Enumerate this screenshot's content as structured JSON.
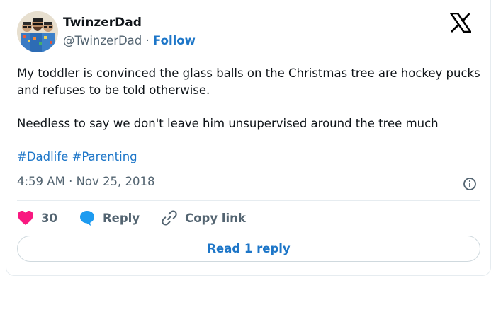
{
  "tweet": {
    "display_name": "TwinzerDad",
    "handle": "@TwinzerDad",
    "separator": "·",
    "follow_label": "Follow",
    "body_line_1": "My toddler is convinced the glass balls on the Christmas tree are hockey pucks and refuses to be told otherwise.",
    "body_line_2": "Needless to say we don't leave him unsupervised around the tree much",
    "hashtags": [
      "#Dadlife",
      "#Parenting"
    ],
    "time": "4:59 AM",
    "date": "Nov 25, 2018",
    "like_count": "30",
    "reply_label": "Reply",
    "copy_link_label": "Copy link",
    "read_reply_label": "Read 1 reply"
  },
  "icons": {
    "brand": "x-logo-icon",
    "like": "heart-icon",
    "reply": "reply-bubble-icon",
    "copy": "link-icon",
    "info": "info-icon"
  },
  "colors": {
    "link": "#1d76c8",
    "heart": "#f91880",
    "reply_bubble": "#1d9bf0",
    "muted_text": "#536471",
    "border": "#cfd9de"
  }
}
